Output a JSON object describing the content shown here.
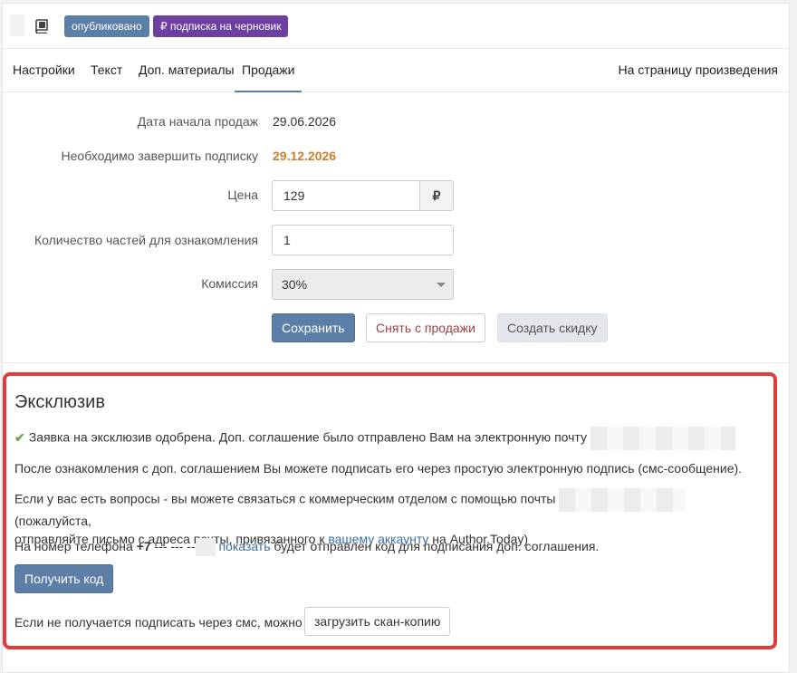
{
  "topbar": {
    "badge_published": "опубликовано",
    "badge_subscription": "₽ подписка на черновик",
    "book_icon": "book-icon"
  },
  "tabs": {
    "items": [
      "Настройки",
      "Текст",
      "Доп. материалы",
      "Продажи"
    ],
    "active": "Продажи",
    "right_link": "На страницу произведения"
  },
  "form": {
    "start_label": "Дата начала продаж",
    "start_value": "29.06.2026",
    "end_label": "Необходимо завершить подписку",
    "end_value": "29.12.2026",
    "price_label": "Цена",
    "price_value": "129",
    "currency": "₽",
    "parts_label": "Количество частей для ознакомления",
    "parts_value": "1",
    "commission_label": "Комиссия",
    "commission_value": "30%",
    "save_button": "Сохранить",
    "unpublish_button": "Снять с продажи",
    "discount_button": "Создать скидку"
  },
  "exclusive": {
    "title": "Эксклюзив",
    "approved_text": "Заявка на эксклюзив одобрена. Доп. соглашение было отправлено Вам на электронную почту",
    "sign_text": "После ознакомления с доп. соглашением Вы можете подписать его через простую электронную подпись (смс-сообщение).",
    "questions_text_1": "Если у вас есть вопросы - вы можете связаться с коммерческим отделом с помощью почты",
    "questions_text_2": "(пожалуйста,",
    "questions_text_3": "отправляйте письмо с адреса почты, привязанного к",
    "account_link": "вашему аккаунту",
    "questions_text_4": "на Author.Today)",
    "phone_prefix": "На номер телефона",
    "phone_code": "+7",
    "phone_masked": "--- --- --",
    "show_link": "показать",
    "phone_suffix": "будет отправлен код для подписания доп. соглашения.",
    "get_code_button": "Получить код",
    "scan_text": "Если не получается подписать через смс, можно",
    "scan_button": "загрузить скан-копию"
  },
  "colors": {
    "accent": "#5b7fa6",
    "subscription_badge": "#6c3fa0",
    "highlight_border": "#e03c3c",
    "deadline": "#c9812f"
  }
}
